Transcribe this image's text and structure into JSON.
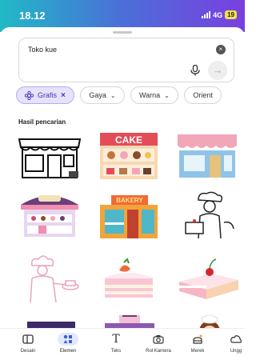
{
  "status": {
    "time": "18.12",
    "network": "4G",
    "battery": "19"
  },
  "search": {
    "query": "Toko kue"
  },
  "filters": [
    {
      "label": "Grafis",
      "active": true
    },
    {
      "label": "Gaya"
    },
    {
      "label": "Warna"
    },
    {
      "label": "Orient"
    }
  ],
  "results": {
    "title": "Hasil pencarian",
    "items": [
      "storefront-line-icon",
      "cake-shop-illustration",
      "bakery-storefront-illustration",
      "cake-stall-illustration",
      "bakery-sign-shop-illustration",
      "chef-with-cake-sketch",
      "chef-outline-illustration",
      "strawberry-cake-slice",
      "cherry-cake-slice",
      "bakery-building-illustration",
      "cake-shop-purple-illustration",
      "girl-baker-illustration"
    ]
  },
  "nav": [
    {
      "label": "Desain",
      "icon": "design-icon"
    },
    {
      "label": "Elemen",
      "icon": "elements-icon",
      "active": true
    },
    {
      "label": "Teks",
      "icon": "text-icon"
    },
    {
      "label": "Rol Kamera",
      "icon": "camera-roll-icon"
    },
    {
      "label": "Merek",
      "icon": "brand-icon"
    },
    {
      "label": "Ungg",
      "icon": "upload-icon"
    }
  ],
  "colors": {
    "accent": "#4a34b6",
    "status_gradient_start": "#20b9c7",
    "status_gradient_end": "#7a3fe0"
  }
}
